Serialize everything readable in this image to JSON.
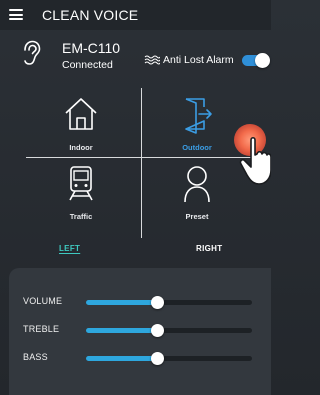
{
  "header": {
    "title": "CLEAN VOICE"
  },
  "device": {
    "name": "EM-C110",
    "status": "Connected",
    "anti_lost_alarm_label": "Anti Lost Alarm",
    "anti_lost_alarm_on": true
  },
  "modes": [
    {
      "label": "Indoor",
      "icon": "house-icon",
      "active": false
    },
    {
      "label": "Outdoor",
      "icon": "door-exit-icon",
      "active": true
    },
    {
      "label": "Traffic",
      "icon": "train-icon",
      "active": false
    },
    {
      "label": "Preset",
      "icon": "person-icon",
      "active": false
    }
  ],
  "sides": {
    "left": {
      "label": "LEFT",
      "active": true
    },
    "right": {
      "label": "RIGHT",
      "active": false
    }
  },
  "equalizer": [
    {
      "label": "VOLUME",
      "level": 0.43
    },
    {
      "label": "TREBLE",
      "level": 0.43
    },
    {
      "label": "BASS",
      "level": 0.43
    }
  ],
  "colors": {
    "accent_blue": "#3b9de4",
    "accent_teal": "#3ec9c0",
    "slider_fill": "#2ea7de",
    "background": "#2b3036"
  }
}
